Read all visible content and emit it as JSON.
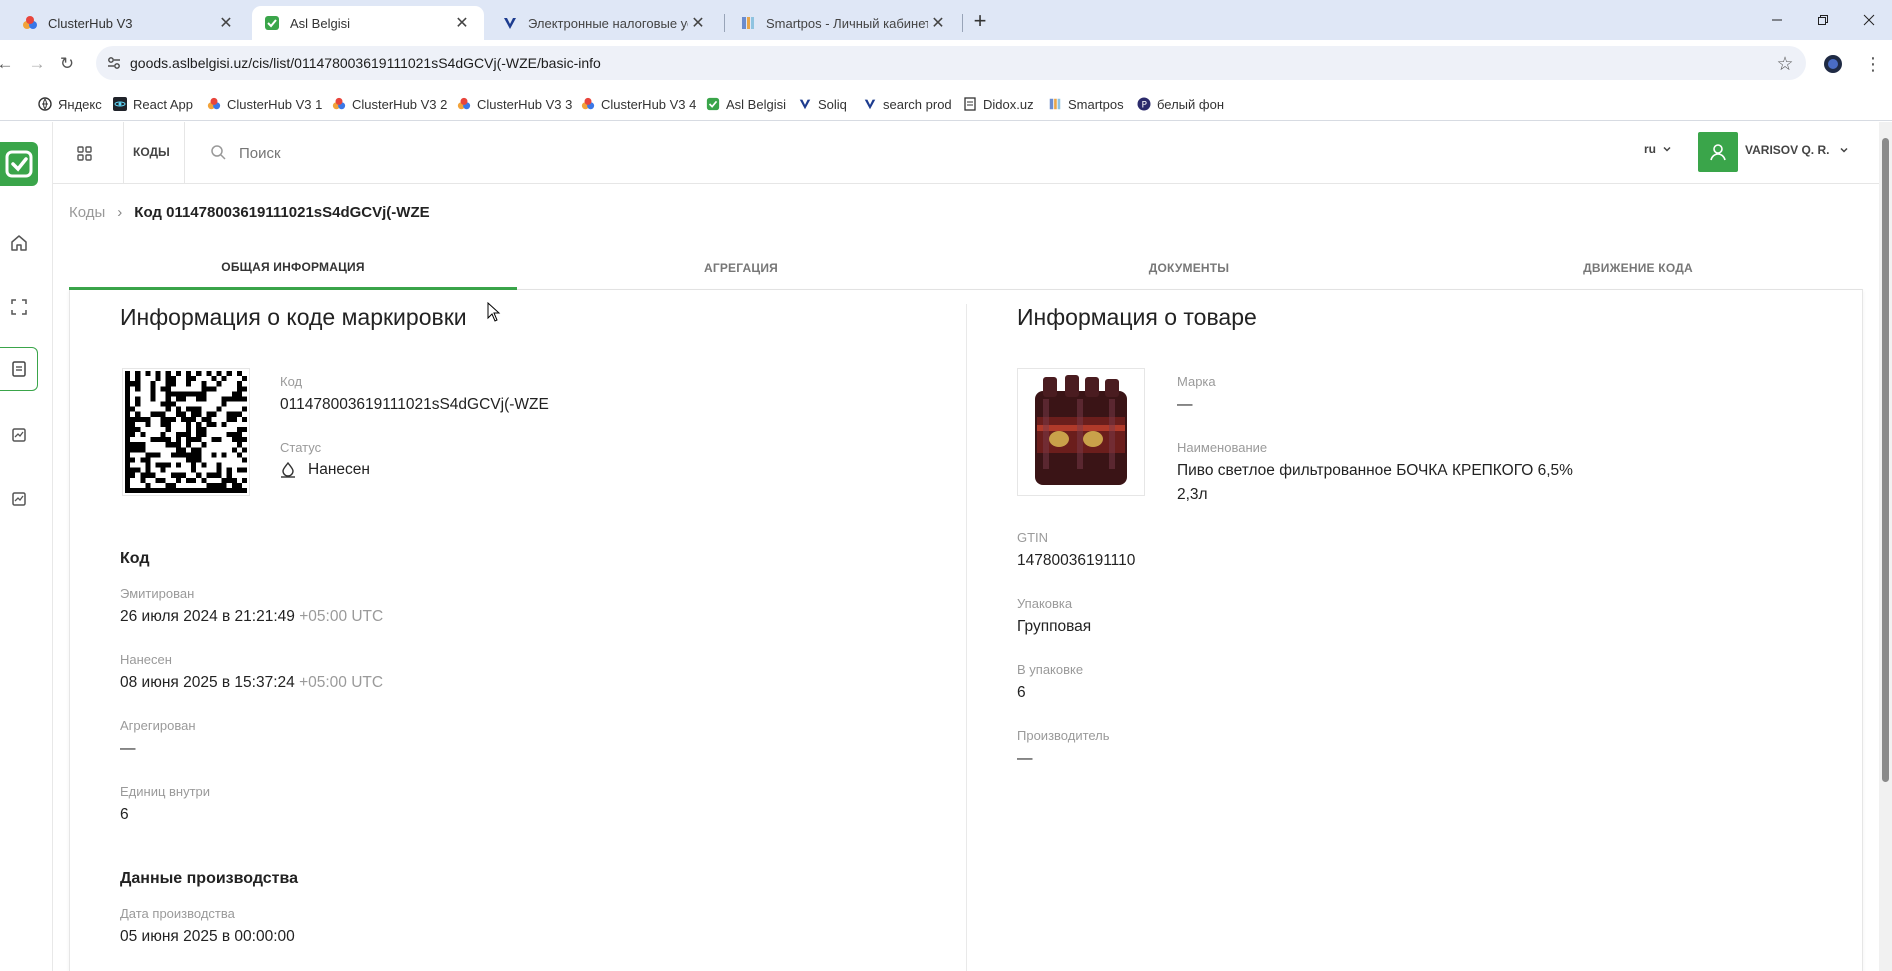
{
  "browser": {
    "tabs": [
      {
        "title": "ClusterHub V3",
        "icon": "clusterhub-icon"
      },
      {
        "title": "Asl Belgisi",
        "icon": "asl-belgisi-icon"
      },
      {
        "title": "Электронные налоговые услуги",
        "icon": "soliq-icon"
      },
      {
        "title": "Smartpos - Личный кабинет владельца",
        "icon": "smartpos-icon"
      }
    ],
    "url": "goods.aslbelgisi.uz/cis/list/011478003619111021sS4dGCVj(-WZE/basic-info",
    "bookmarks": [
      {
        "label": "Яндекс",
        "icon": "yandex-icon"
      },
      {
        "label": "React App",
        "icon": "react-icon"
      },
      {
        "label": "ClusterHub V3 1",
        "icon": "clusterhub-icon"
      },
      {
        "label": "ClusterHub V3 2",
        "icon": "clusterhub-icon"
      },
      {
        "label": "ClusterHub V3 3",
        "icon": "clusterhub-icon"
      },
      {
        "label": "ClusterHub V3 4",
        "icon": "clusterhub-icon"
      },
      {
        "label": "Asl Belgisi",
        "icon": "asl-belgisi-icon"
      },
      {
        "label": "Soliq",
        "icon": "soliq-icon"
      },
      {
        "label": "search prod",
        "icon": "soliq-icon"
      },
      {
        "label": "Didox.uz",
        "icon": "didox-icon"
      },
      {
        "label": "Smartpos",
        "icon": "smartpos-icon"
      },
      {
        "label": "белый фон",
        "icon": "white-bg-icon"
      }
    ]
  },
  "header": {
    "menu_label": "КОДЫ",
    "search_placeholder": "Поиск",
    "lang": "ru",
    "user": "VARISOV Q. R."
  },
  "breadcrumb": {
    "parent": "Коды",
    "current": "Код 011478003619111021sS4dGCVj(-WZE"
  },
  "page_tabs": [
    "ОБЩАЯ ИНФОРМАЦИЯ",
    "АГРЕГАЦИЯ",
    "ДОКУМЕНТЫ",
    "ДВИЖЕНИЕ КОДА"
  ],
  "code_info": {
    "title": "Информация о коде маркировки",
    "code_label": "Код",
    "code_value": "011478003619111021sS4dGCVj(-WZE",
    "status_label": "Статус",
    "status_value": "Нанесен",
    "section_code": "Код",
    "emitted_label": "Эмитирован",
    "emitted_value": "26 июля 2024 в 21:21:49",
    "emitted_tz": "+05:00 UTC",
    "applied_label": "Нанесен",
    "applied_value": "08 июня 2025 в 15:37:24",
    "applied_tz": "+05:00 UTC",
    "aggregated_label": "Агрегирован",
    "aggregated_value": "—",
    "units_label": "Единиц внутри",
    "units_value": "6",
    "section_production": "Данные производства",
    "production_date_label": "Дата производства",
    "production_date_value": "05 июня 2025 в 00:00:00"
  },
  "product_info": {
    "title": "Информация о товаре",
    "brand_label": "Марка",
    "brand_value": "—",
    "name_label": "Наименование",
    "name_value_line1": "Пиво светлое фильтрованное БОЧКА КРЕПКОГО 6,5%",
    "name_value_line2": "2,3л",
    "gtin_label": "GTIN",
    "gtin_value": "14780036191110",
    "package_label": "Упаковка",
    "package_value": "Групповая",
    "in_package_label": "В упаковке",
    "in_package_value": "6",
    "manufacturer_label": "Производитель",
    "manufacturer_value": "—"
  },
  "colors": {
    "accent": "#3aa54a",
    "tab_strip": "#dfe7f6"
  }
}
